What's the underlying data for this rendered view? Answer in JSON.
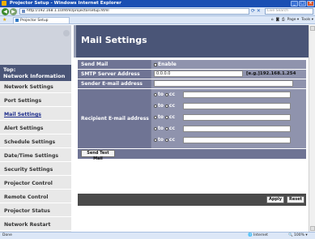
{
  "window": {
    "title": "Projector Setup - Windows Internet Explorer",
    "address": "http://192.168.1.10/html/projectorsetup.html",
    "search_placeholder": "Live Search",
    "tab_label": "Projector Setup",
    "cmd_page": "Page",
    "cmd_tools": "Tools"
  },
  "nav": {
    "top_label": "Top:",
    "top_section": "Network Information",
    "items": [
      "Network Settings",
      "Port Settings",
      "Mail Settings",
      "Alert Settings",
      "Schedule Settings",
      "Date/Time Settings",
      "Security Settings",
      "Projector Control",
      "Remote Control",
      "Projector Status",
      "Network Restart"
    ],
    "active_item": "Mail Settings"
  },
  "page": {
    "title": "Mail Settings"
  },
  "form": {
    "send_mail_label": "Send Mail",
    "enable_label": "Enable",
    "smtp_label": "SMTP Server Address",
    "smtp_value": "0.0.0.0",
    "smtp_example": "[e.g.]192.168.1.254",
    "sender_label": "Sender E-mail address",
    "sender_value": "",
    "recipient_label": "Recipient E-mail address",
    "recipients": [
      {
        "to_label": "to",
        "cc_label": "cc",
        "value": ""
      },
      {
        "to_label": "to",
        "cc_label": "cc",
        "value": ""
      },
      {
        "to_label": "to",
        "cc_label": "cc",
        "value": ""
      },
      {
        "to_label": "to",
        "cc_label": "cc",
        "value": ""
      },
      {
        "to_label": "to",
        "cc_label": "cc",
        "value": ""
      }
    ],
    "send_test_label": "Send Test Mail",
    "apply_label": "Apply",
    "reset_label": "Reset"
  },
  "status": {
    "left": "Done",
    "zone": "Internet",
    "zoom": "100%"
  },
  "colors": {
    "nav_header": "#4a5577",
    "form_label_bg": "#6f7494",
    "form_value_bg": "#8f93ad"
  }
}
